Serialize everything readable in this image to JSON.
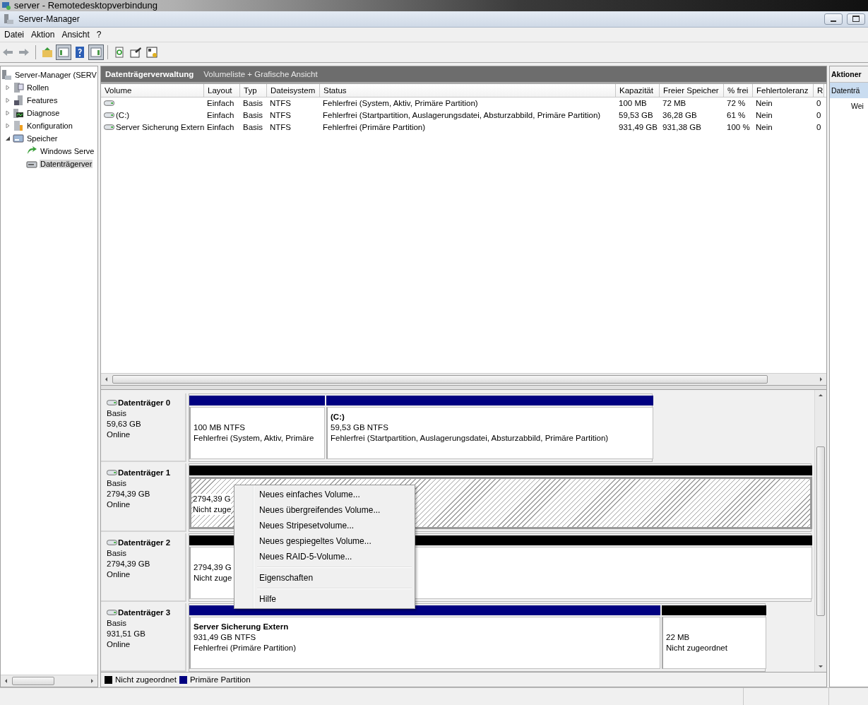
{
  "rdp_title": "server - Remotedesktopverbindung",
  "window": {
    "title": "Server-Manager"
  },
  "menu": [
    "Datei",
    "Aktion",
    "Ansicht",
    "?"
  ],
  "toolbar": [
    {
      "kind": "back",
      "pressed": false
    },
    {
      "kind": "forward",
      "pressed": false
    },
    {
      "kind": "up",
      "pressed": false
    },
    {
      "kind": "tree",
      "pressed": true
    },
    {
      "kind": "help",
      "pressed": false
    },
    {
      "kind": "actions",
      "pressed": true
    },
    {
      "kind": "refresh",
      "pressed": false
    },
    {
      "kind": "properties",
      "pressed": false
    },
    {
      "kind": "export",
      "pressed": false
    }
  ],
  "tree": {
    "label": "Server-Manager (SERV",
    "selected": false,
    "children": [
      {
        "label": "Rollen",
        "expanded": false,
        "selected": false
      },
      {
        "label": "Features",
        "expanded": false,
        "selected": false
      },
      {
        "label": "Diagnose",
        "expanded": false,
        "selected": false
      },
      {
        "label": "Konfiguration",
        "expanded": false,
        "selected": false
      },
      {
        "label": "Speicher",
        "expanded": true,
        "selected": false,
        "children": [
          {
            "label": "Windows Serve",
            "selected": false
          },
          {
            "label": "Datenträgerver",
            "selected": true
          }
        ]
      }
    ]
  },
  "center": {
    "title": "Datenträgerverwaltung",
    "subtitle": "Volumeliste + Grafische Ansicht",
    "table": {
      "columns": [
        "Volume",
        "Layout",
        "Typ",
        "Dateisystem",
        "Status",
        "Kapazität",
        "Freier Speicher",
        "% frei",
        "Fehlertoleranz",
        "R"
      ],
      "rows": [
        [
          "",
          "Einfach",
          "Basis",
          "NTFS",
          "Fehlerfrei (System, Aktiv, Primäre Partition)",
          "100 MB",
          "72 MB",
          "72 %",
          "Nein",
          "0"
        ],
        [
          "(C:)",
          "Einfach",
          "Basis",
          "NTFS",
          "Fehlerfrei (Startpartition, Auslagerungsdatei, Absturzabbild, Primäre Partition)",
          "59,53 GB",
          "36,28 GB",
          "61 %",
          "Nein",
          "0"
        ],
        [
          "Server Sicherung Extern",
          "Einfach",
          "Basis",
          "NTFS",
          "Fehlerfrei (Primäre Partition)",
          "931,49 GB",
          "931,38 GB",
          "100 %",
          "Nein",
          "0"
        ]
      ]
    },
    "disks": [
      {
        "name": "Datenträger 0",
        "type": "Basis",
        "size": "59,63 GB",
        "status": "Online",
        "partitions": [
          {
            "kind": "primary",
            "selected": false,
            "lines": [
              "100 MB NTFS",
              "Fehlerfrei (System, Aktiv, Primäre"
            ]
          },
          {
            "kind": "primary",
            "selected": false,
            "title": "(C:)",
            "lines": [
              "59,53 GB NTFS",
              "Fehlerfrei (Startpartition, Auslagerungsdatei, Absturzabbild, Primäre Partition)"
            ]
          }
        ]
      },
      {
        "name": "Datenträger 1",
        "type": "Basis",
        "size": "2794,39 GB",
        "status": "Online",
        "partitions": [
          {
            "kind": "unallocated",
            "selected": true,
            "lines": [
              "2794,39 G",
              "Nicht zuge"
            ]
          }
        ]
      },
      {
        "name": "Datenträger 2",
        "type": "Basis",
        "size": "2794,39 GB",
        "status": "Online",
        "partitions": [
          {
            "kind": "unallocated",
            "selected": false,
            "lines": [
              "2794,39 G",
              "Nicht zuge"
            ]
          }
        ]
      },
      {
        "name": "Datenträger 3",
        "type": "Basis",
        "size": "931,51 GB",
        "status": "Online",
        "partitions": [
          {
            "kind": "primary",
            "selected": false,
            "title": "Server Sicherung Extern",
            "lines": [
              "931,49 GB NTFS",
              "Fehlerfrei (Primäre Partition)"
            ]
          },
          {
            "kind": "unallocated",
            "selected": false,
            "lines": [
              "22 MB",
              "Nicht zugeordnet"
            ]
          }
        ]
      }
    ],
    "legend": [
      {
        "label": "Nicht zugeordnet",
        "color": "#000000"
      },
      {
        "label": "Primäre Partition",
        "color": "#000080"
      }
    ]
  },
  "context_menu": {
    "groups": [
      {
        "items": [
          "Neues einfaches Volume...",
          "Neues übergreifendes Volume...",
          "Neues Stripesetvolume...",
          "Neues gespiegeltes Volume...",
          "Neues RAID-5-Volume..."
        ]
      },
      {
        "items": [
          "Eigenschaften"
        ]
      },
      {
        "items": [
          "Hilfe"
        ]
      }
    ]
  },
  "actions": {
    "title": "Aktioner",
    "items": [
      {
        "label": "Datenträ",
        "selected": true
      },
      {
        "label": "Wei",
        "selected": false
      }
    ]
  }
}
